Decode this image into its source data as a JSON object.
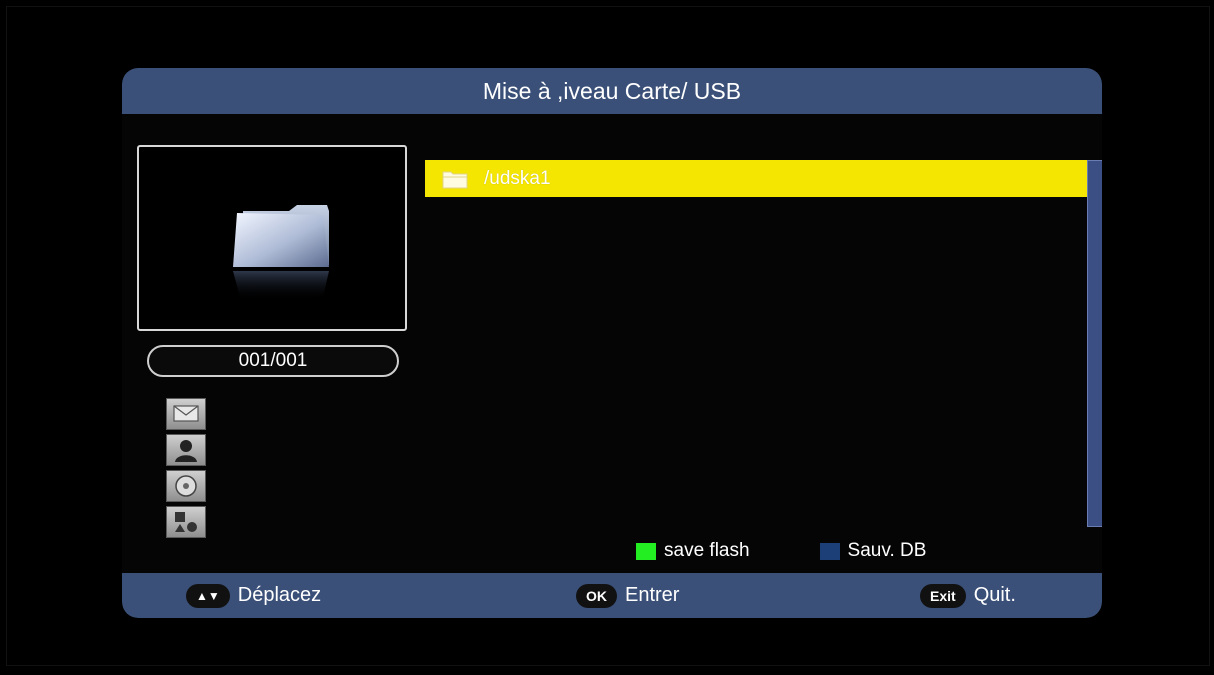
{
  "window": {
    "title": "Mise à ,iveau Carte/ USB"
  },
  "preview": {
    "icon": "folder-icon"
  },
  "counter": {
    "text": "001/001"
  },
  "media_icons": [
    "mail-icon",
    "person-icon",
    "disc-icon",
    "apps-icon"
  ],
  "file_list": {
    "items": [
      {
        "name": "/udska1",
        "icon": "folder-icon",
        "selected": true
      }
    ]
  },
  "legend": {
    "items": [
      {
        "label": "save flash",
        "color": "#22ee22"
      },
      {
        "label": "Sauv. DB",
        "color": "#1d3f78"
      }
    ]
  },
  "footer": {
    "move": {
      "key": "▲▼",
      "label": "Déplacez"
    },
    "ok": {
      "key": "OK",
      "label": "Entrer"
    },
    "exit": {
      "key": "Exit",
      "label": "Quit."
    }
  },
  "colors": {
    "panel": "#3b5078",
    "highlight": "#f4e600",
    "scrollbar": "#3c4f85"
  }
}
